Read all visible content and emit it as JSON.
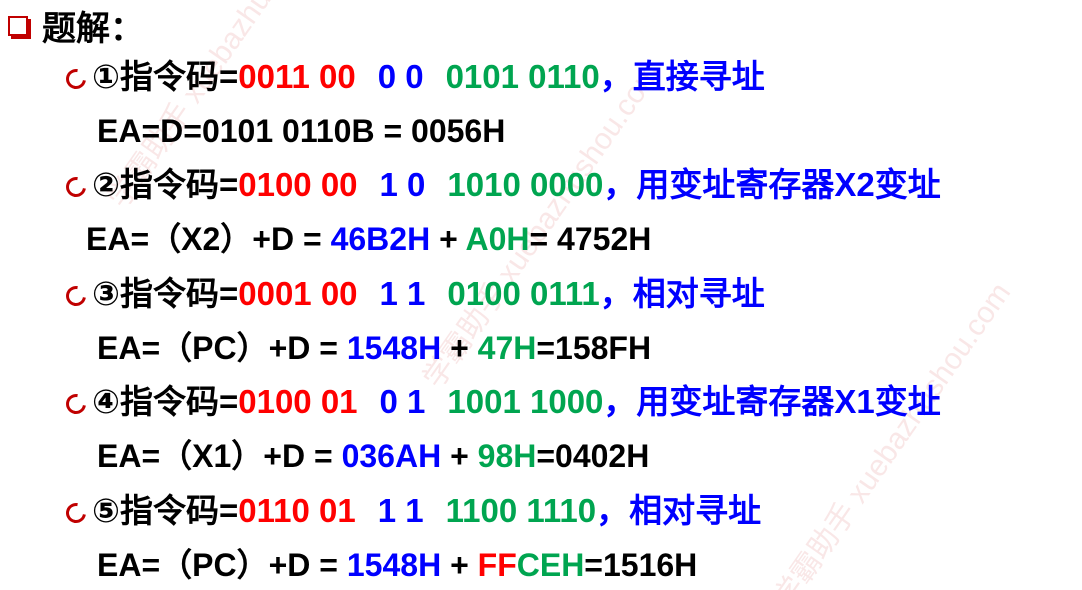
{
  "title": "题解：",
  "watermark": "学霸助手  xuebazhushou.com",
  "items": [
    {
      "num": "①",
      "prefix": "指令码=",
      "op": "0011 00",
      "mode": "0 0",
      "disp": "0101 0110",
      "sep": "，",
      "desc": "直接寻址",
      "ea": [
        {
          "t": "EA=D=0101 0110B = 0056H",
          "c": "black"
        }
      ]
    },
    {
      "num": "②",
      "prefix": "指令码=",
      "op": "0100 00",
      "mode": "1 0",
      "disp": "1010 0000",
      "sep": "，",
      "desc": "用变址寄存器X2变址",
      "ea": [
        {
          "t": "EA=（X2）+D = ",
          "c": "black"
        },
        {
          "t": "46B2H",
          "c": "blue"
        },
        {
          "t": " + ",
          "c": "black"
        },
        {
          "t": "A0H",
          "c": "green"
        },
        {
          "t": "= 4752H",
          "c": "black"
        }
      ]
    },
    {
      "num": "③",
      "prefix": "指令码=",
      "op": "0001 00",
      "mode": "1 1",
      "disp": "0100 0111",
      "sep": "，",
      "desc": "相对寻址",
      "ea": [
        {
          "t": "EA=（PC）+D = ",
          "c": "black"
        },
        {
          "t": "1548H",
          "c": "blue"
        },
        {
          "t": " + ",
          "c": "black"
        },
        {
          "t": "47H",
          "c": "green"
        },
        {
          "t": "=158FH",
          "c": "black"
        }
      ]
    },
    {
      "num": "④",
      "prefix": "指令码=",
      "op": "0100 01",
      "mode": "0 1",
      "disp": "1001 1000",
      "sep": "，",
      "desc": "用变址寄存器X1变址",
      "ea": [
        {
          "t": "EA=（X1）+D = ",
          "c": "black"
        },
        {
          "t": "036AH",
          "c": "blue"
        },
        {
          "t": " + ",
          "c": "black"
        },
        {
          "t": "98H",
          "c": "green"
        },
        {
          "t": "=0402H",
          "c": "black"
        }
      ]
    },
    {
      "num": "⑤",
      "prefix": "指令码=",
      "op": "0110 01",
      "mode": "1 1",
      "disp": "1100 1110",
      "sep": "，",
      "desc": "相对寻址",
      "ea": [
        {
          "t": "EA=（PC）+D = ",
          "c": "black"
        },
        {
          "t": "1548H",
          "c": "blue"
        },
        {
          "t": " + ",
          "c": "black"
        },
        {
          "t": "FF",
          "c": "red"
        },
        {
          "t": "CEH",
          "c": "green"
        },
        {
          "t": "=1516H",
          "c": "black"
        }
      ]
    }
  ]
}
